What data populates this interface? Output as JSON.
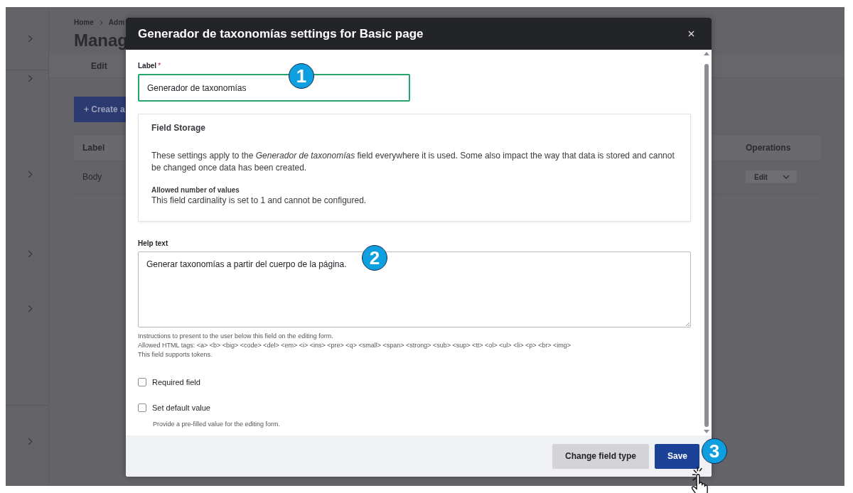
{
  "backdrop": {
    "breadcrumb": [
      "Home",
      "Adm"
    ],
    "page_title": "Manag",
    "tabs": [
      "Edit"
    ],
    "create_button": "+ Create a",
    "table": {
      "columns": [
        "Label",
        "Operations"
      ],
      "rows": [
        {
          "label": "Body",
          "operation": "Edit"
        }
      ]
    }
  },
  "dialog": {
    "title": "Generador de taxonomías settings for Basic page",
    "label_field": {
      "label": "Label",
      "required_mark": "*",
      "value": "Generador de taxonomías",
      "focused": true
    },
    "field_storage": {
      "title": "Field Storage",
      "description": "These settings apply to the *Generador de taxonomías* field everywhere it is used. Some also impact the way that data is stored and cannot be changed once data has been created.",
      "subheading": "Allowed number of values",
      "text": "This field cardinality is set to 1 and cannot be configured."
    },
    "help_text": {
      "label": "Help text",
      "value": "Generar taxonomías a partir del cuerpo de la página.",
      "descriptions": [
        "Instructions to present to the user below this field on the editing form.",
        "Allowed HTML tags: <a> <b> <big> <code> <del> <em> <i> <ins> <pre> <q> <small> <span> <strong> <sub> <sup> <tt> <ol> <ul> <li> <p> <br> <img>",
        "This field supports tokens."
      ]
    },
    "checkboxes": [
      {
        "label": "Required field",
        "checked": false
      },
      {
        "label": "Set default value",
        "checked": false,
        "description": "Provide a pre-filled value for the editing form."
      }
    ],
    "buttons": [
      {
        "label": "Change field type",
        "kind": "secondary"
      },
      {
        "label": "Save",
        "kind": "primary"
      }
    ]
  },
  "callouts": [
    "1",
    "2",
    "3"
  ]
}
